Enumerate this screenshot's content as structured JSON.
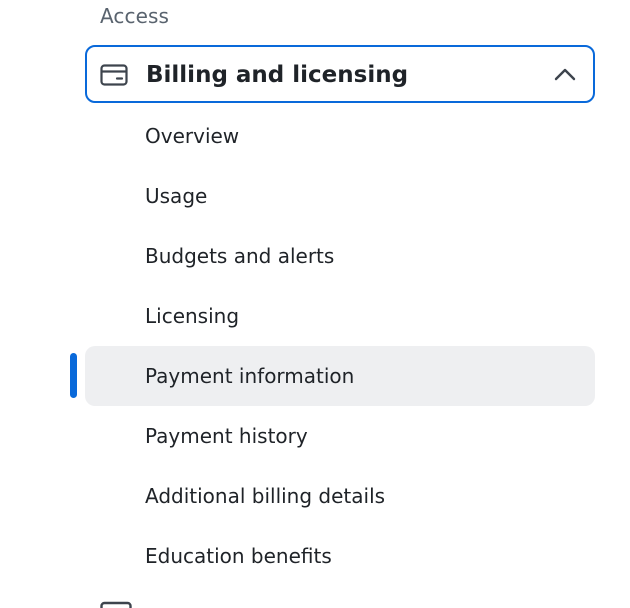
{
  "section": {
    "heading": "Access"
  },
  "group": {
    "title": "Billing and licensing",
    "icon": "credit-card-icon",
    "expanded": true,
    "accent_color": "#0969da"
  },
  "nav": {
    "items": [
      {
        "label": "Overview",
        "active": false
      },
      {
        "label": "Usage",
        "active": false
      },
      {
        "label": "Budgets and alerts",
        "active": false
      },
      {
        "label": "Licensing",
        "active": false
      },
      {
        "label": "Payment information",
        "active": true
      },
      {
        "label": "Payment history",
        "active": false
      },
      {
        "label": "Additional billing details",
        "active": false
      },
      {
        "label": "Education benefits",
        "active": false
      }
    ]
  },
  "next_group": {
    "icon": "mail-icon"
  },
  "colors": {
    "active_background": "#eeeff1",
    "text": "#1f2328",
    "muted_text": "#59636e"
  }
}
